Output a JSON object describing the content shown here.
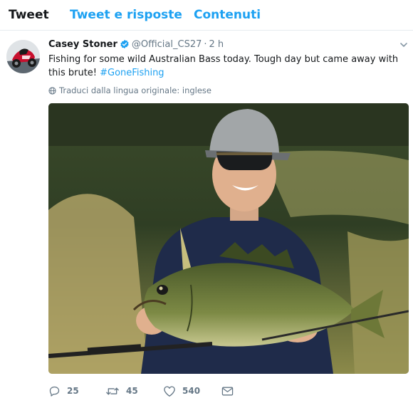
{
  "tabs": [
    {
      "label": "Tweet",
      "active": true
    },
    {
      "label": "Tweet e risposte",
      "active": false
    },
    {
      "label": "Contenuti",
      "active": false
    }
  ],
  "tweet": {
    "fullname": "Casey Stoner",
    "handle": "@Official_CS27",
    "separator": "·",
    "time": "2 h",
    "text_body": "Fishing for some wild Australian Bass today. Tough day but came away with this brute! ",
    "hashtag": "#GoneFishing",
    "translate_label": "Traduci dalla lingua originale: inglese",
    "counts": {
      "replies": "25",
      "retweets": "45",
      "likes": "540"
    }
  },
  "colors": {
    "accent": "#1da1f2",
    "muted": "#657786",
    "text": "#14171a",
    "border": "#e6ecf0"
  },
  "icons": [
    "verified-badge-icon",
    "chevron-down-icon",
    "globe-icon",
    "reply-icon",
    "retweet-icon",
    "heart-icon",
    "envelope-icon"
  ]
}
